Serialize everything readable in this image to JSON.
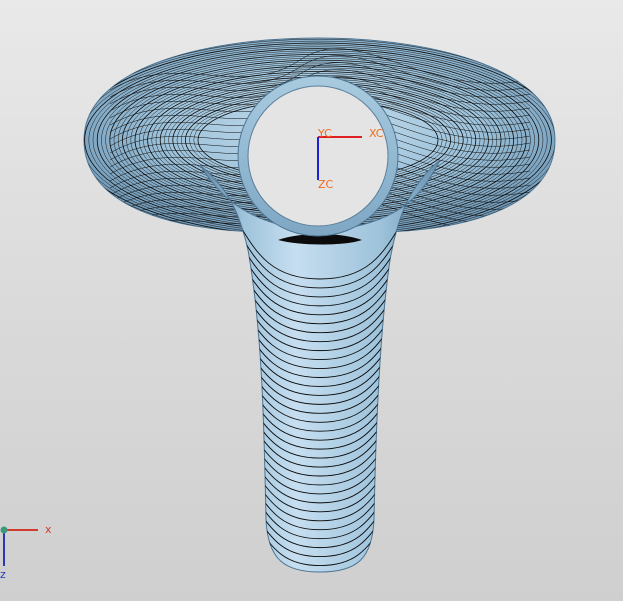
{
  "viewport": {
    "background_top": "#e9e9e9",
    "background_bottom": "#cfcfcf"
  },
  "model": {
    "surface_color": "#9ec3db",
    "contour_color": "#0b0b0b",
    "shading_dark": "#5f88a6"
  },
  "csys": {
    "xc_label": "XC",
    "yc_label": "YC",
    "zc_label": "ZC",
    "x_color": "#e02020",
    "z_color": "#2020d8",
    "label_color": "#f26b1d"
  },
  "wcs_triad": {
    "x_label": "x",
    "z_label": "z",
    "x_color": "#d23b2b",
    "z_color": "#2c34b8",
    "origin_color": "#3c9a7a"
  }
}
